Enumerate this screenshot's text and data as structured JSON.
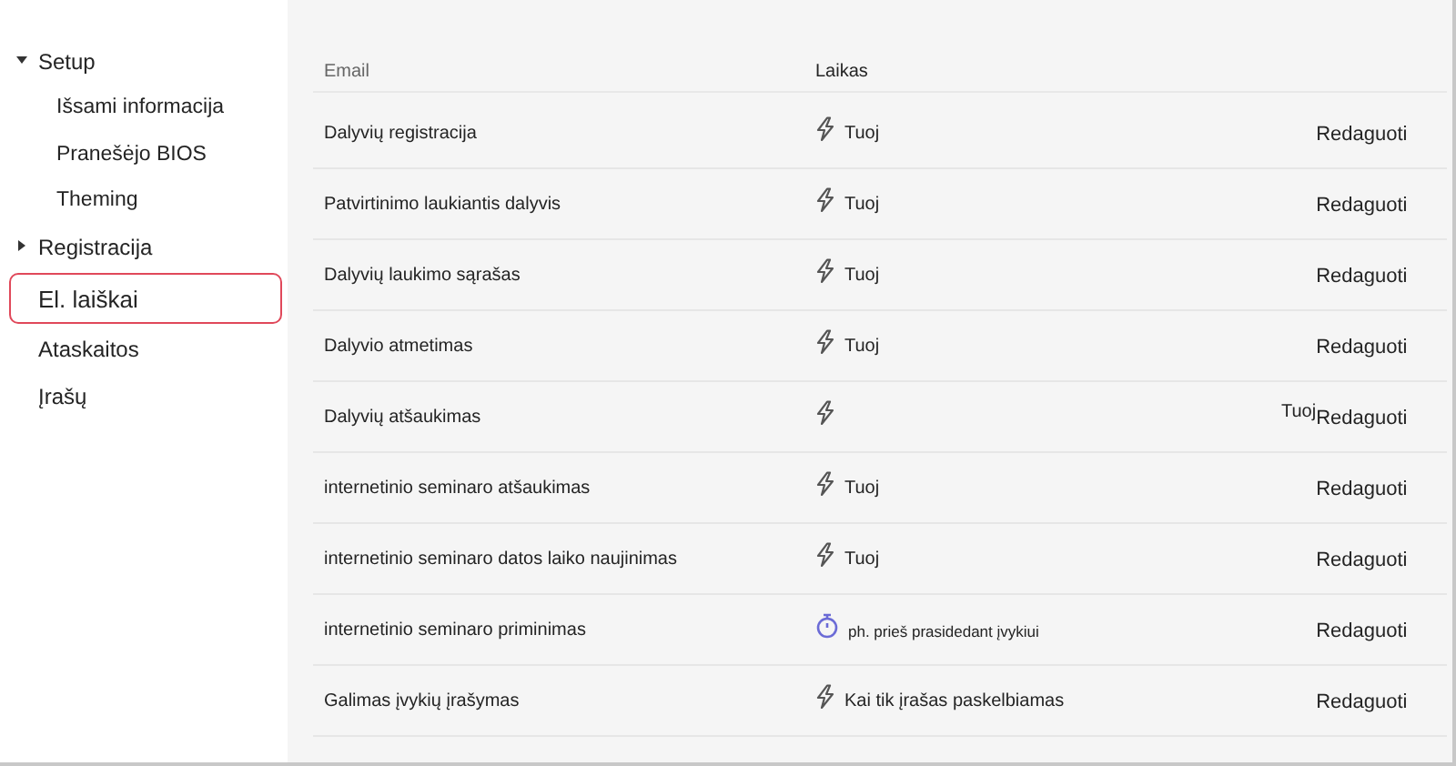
{
  "sidebar": {
    "items": [
      {
        "label": "Setup",
        "expanded": true,
        "selected": false,
        "children": [
          {
            "label": "Išsami informacija",
            "selected": false
          },
          {
            "label": "Pranešėjo BIOS",
            "selected": false
          },
          {
            "label": "Theming",
            "selected": false
          }
        ]
      },
      {
        "label": "Registracija",
        "expanded": false,
        "selected": false
      },
      {
        "label": "El. laiškai",
        "selected": true
      },
      {
        "label": "Ataskaitos",
        "selected": false
      },
      {
        "label": "Įrašų",
        "selected": false
      }
    ]
  },
  "table": {
    "columns": [
      "Email",
      "Laikas"
    ],
    "rows": [
      {
        "email": "Dalyvių registracija",
        "kind": "instant",
        "trigger": "Tuoj",
        "action": "Redaguoti"
      },
      {
        "email": "Patvirtinimo laukiantis dalyvis",
        "kind": "instant",
        "trigger": "Tuoj",
        "action": "Redaguoti"
      },
      {
        "email": "Dalyvių laukimo sąrašas",
        "kind": "instant",
        "trigger": "Tuoj",
        "action": "Redaguoti"
      },
      {
        "email": "Dalyvio atmetimas",
        "kind": "instant",
        "trigger": "Tuoj",
        "action": "Redaguoti"
      },
      {
        "email": "Dalyvių atšaukimas",
        "kind": "instant-shifted",
        "trigger": "Tuoj",
        "action": "Redaguoti"
      },
      {
        "email": "internetinio seminaro atšaukimas",
        "kind": "instant",
        "trigger": "Tuoj",
        "action": "Redaguoti"
      },
      {
        "email": "internetinio seminaro datos laiko naujinimas",
        "kind": "instant",
        "trigger": "Tuoj",
        "action": "Redaguoti"
      },
      {
        "email": "internetinio seminaro priminimas",
        "kind": "timer",
        "trigger": "ph. prieš prasidedant įvykiui",
        "action": "Redaguoti"
      },
      {
        "email": "Galimas įvykių įrašymas",
        "kind": "instant",
        "trigger": "Kai tik įrašas paskelbiamas",
        "action": "Redaguoti"
      }
    ]
  }
}
